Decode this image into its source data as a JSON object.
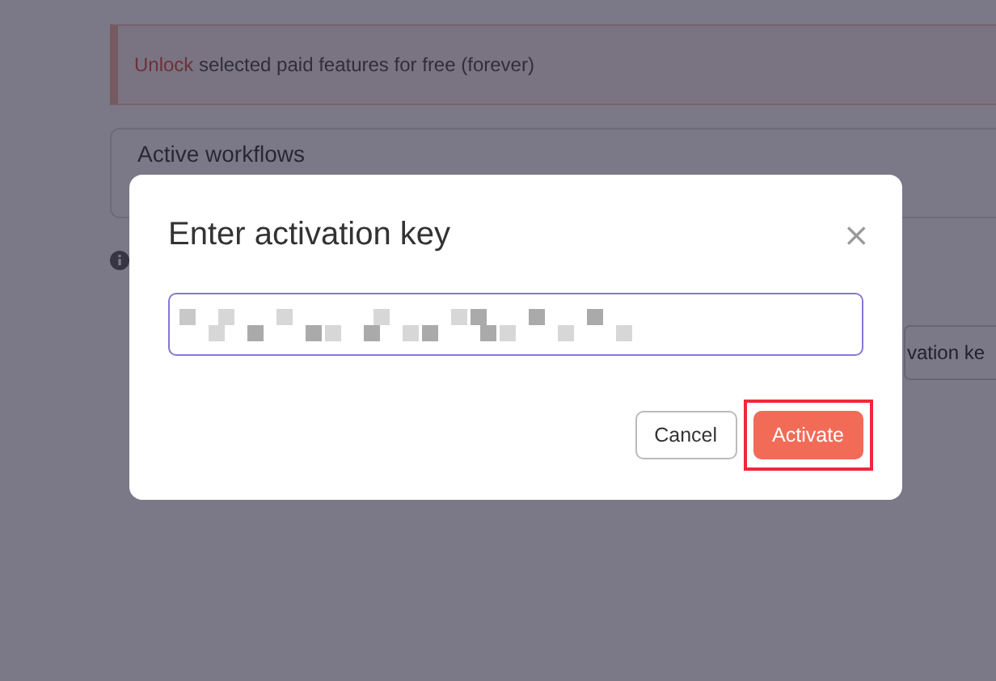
{
  "background": {
    "banner": {
      "link": "Unlock",
      "text": "selected paid features for free (forever)"
    },
    "card_title": "Active workflows",
    "button": "vation ke"
  },
  "dialog": {
    "title": "Enter activation key",
    "close": "×",
    "buttons": [
      {
        "label": "Cancel",
        "kind": "secondary",
        "highlighted": false
      },
      {
        "label": "Activate",
        "kind": "primary",
        "highlighted": true
      }
    ]
  }
}
